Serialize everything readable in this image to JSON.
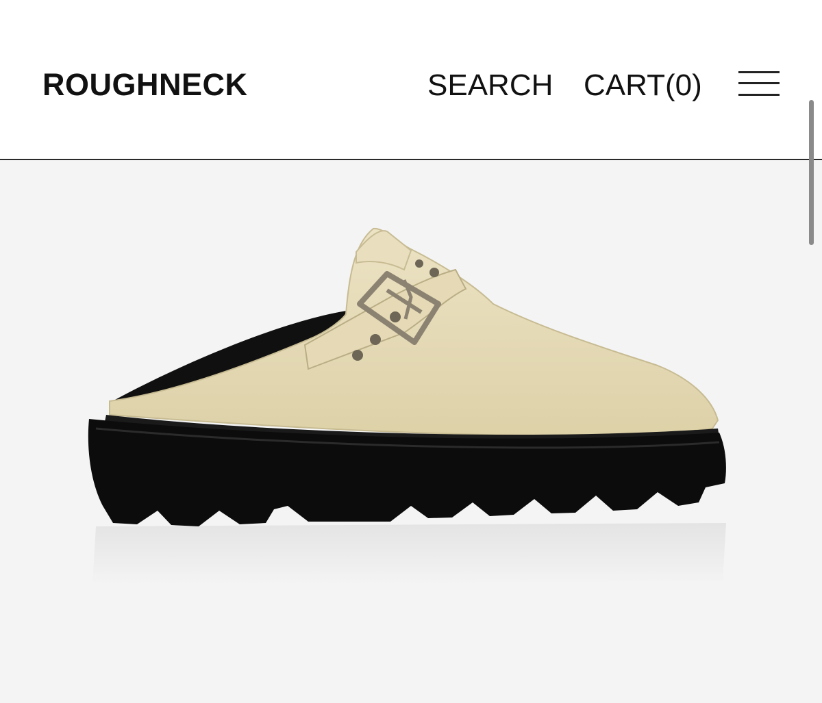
{
  "header": {
    "brand": "ROUGHNECK",
    "search_label": "SEARCH",
    "cart_label": "CART(0)",
    "menu_icon": "hamburger-menu-icon"
  },
  "hero": {
    "image_subject": "product-photo",
    "colors": {
      "background": "#f4f4f4",
      "upper": "#e6dcb8",
      "sole": "#0c0c0c",
      "buckle": "#8c8272"
    }
  }
}
